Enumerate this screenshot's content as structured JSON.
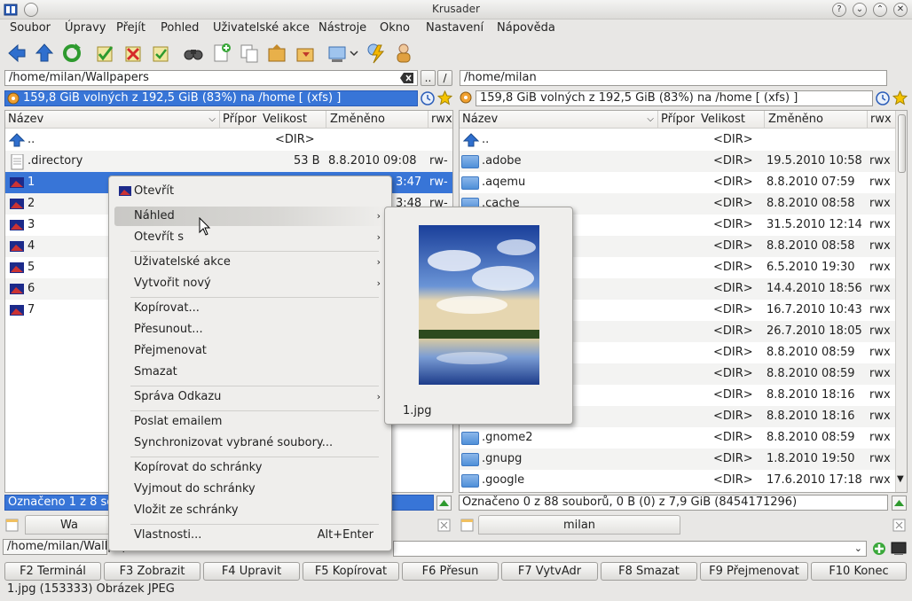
{
  "window": {
    "title": "Krusader"
  },
  "menubar": [
    "Soubor",
    "Úpravy",
    "Přejít",
    "Pohled",
    "Uživatelské akce",
    "Nástroje",
    "Okno",
    "Nastavení",
    "Nápověda"
  ],
  "left": {
    "path": "/home/milan/Wallpapers",
    "free": "159,8 GiB volných z 192,5 GiB (83%) na /home [ (xfs) ]",
    "columns": {
      "name": "Název",
      "ext": "Přípor",
      "size": "Velikost",
      "modified": "Změněno",
      "perm": "rwx"
    },
    "rows": [
      {
        "name": "..",
        "size": "<DIR>",
        "date": "",
        "perm": ""
      },
      {
        "name": ".directory",
        "size": "53 B",
        "date": "8.8.2010 09:08",
        "perm": "rw-"
      },
      {
        "name": "1",
        "size": "",
        "date": "3:47",
        "perm": "rw-"
      },
      {
        "name": "2",
        "size": "",
        "date": "3:48",
        "perm": "rw-"
      },
      {
        "name": "3",
        "size": "",
        "date": "",
        "perm": ""
      },
      {
        "name": "4",
        "size": "",
        "date": "",
        "perm": ""
      },
      {
        "name": "5",
        "size": "",
        "date": "",
        "perm": ""
      },
      {
        "name": "6",
        "size": "",
        "date": "",
        "perm": ""
      },
      {
        "name": "7",
        "size": "",
        "date": "",
        "perm": ""
      }
    ],
    "status": "Označeno 1 z 8 soub",
    "tab": "Wa",
    "cmdpath": "/home/milan/Wallpap"
  },
  "right": {
    "path": "/home/milan",
    "free": "159,8 GiB volných z 192,5 GiB (83%) na /home [ (xfs) ]",
    "columns": {
      "name": "Název",
      "ext": "Přípor",
      "size": "Velikost",
      "modified": "Změněno",
      "perm": "rwx"
    },
    "rows": [
      {
        "name": "..",
        "size": "<DIR>",
        "date": "",
        "perm": ""
      },
      {
        "name": ".adobe",
        "size": "<DIR>",
        "date": "19.5.2010 10:58",
        "perm": "rwx"
      },
      {
        "name": ".aqemu",
        "size": "<DIR>",
        "date": "8.8.2010 07:59",
        "perm": "rwx"
      },
      {
        "name": ".cache",
        "size": "<DIR>",
        "date": "8.8.2010 08:58",
        "perm": "rwx"
      },
      {
        "name": "",
        "size": "<DIR>",
        "date": "31.5.2010 12:14",
        "perm": "rwx"
      },
      {
        "name": "",
        "size": "<DIR>",
        "date": "8.8.2010 08:58",
        "perm": "rwx"
      },
      {
        "name": "",
        "size": "<DIR>",
        "date": "6.5.2010 19:30",
        "perm": "rwx"
      },
      {
        "name": "",
        "size": "<DIR>",
        "date": "14.4.2010 18:56",
        "perm": "rwx"
      },
      {
        "name": "",
        "size": "<DIR>",
        "date": "16.7.2010 10:43",
        "perm": "rwx"
      },
      {
        "name": "",
        "size": "<DIR>",
        "date": "26.7.2010 18:05",
        "perm": "rwx"
      },
      {
        "name": "",
        "size": "<DIR>",
        "date": "8.8.2010 08:59",
        "perm": "rwx"
      },
      {
        "name": "",
        "size": "<DIR>",
        "date": "8.8.2010 08:59",
        "perm": "rwx"
      },
      {
        "name": "",
        "size": "<DIR>",
        "date": "8.8.2010 18:16",
        "perm": "rwx"
      },
      {
        "name": "",
        "size": "<DIR>",
        "date": "8.8.2010 18:16",
        "perm": "rwx"
      },
      {
        "name": ".gnome2",
        "size": "<DIR>",
        "date": "8.8.2010 08:59",
        "perm": "rwx"
      },
      {
        "name": ".gnupg",
        "size": "<DIR>",
        "date": "1.8.2010 19:50",
        "perm": "rwx"
      },
      {
        "name": ".google",
        "size": "<DIR>",
        "date": "17.6.2010 17:18",
        "perm": "rwx"
      }
    ],
    "status": "Označeno 0 z 88 souborů, 0 B  (0) z 7,9 GiB (8454171296)",
    "tab": "milan"
  },
  "context_menu": {
    "items": [
      {
        "label": "Otevřít",
        "submenu": false
      },
      {
        "label": "Náhled",
        "submenu": true
      },
      {
        "label": "Otevřít s",
        "submenu": true
      },
      {
        "label": "Uživatelské akce",
        "submenu": true
      },
      {
        "label": "Vytvořit nový",
        "submenu": true
      },
      {
        "label": "Kopírovat...",
        "submenu": false
      },
      {
        "label": "Přesunout...",
        "submenu": false
      },
      {
        "label": "Přejmenovat",
        "submenu": false
      },
      {
        "label": "Smazat",
        "submenu": false
      },
      {
        "label": "Správa Odkazu",
        "submenu": true
      },
      {
        "label": "Poslat emailem",
        "submenu": false
      },
      {
        "label": "Synchronizovat vybrané soubory...",
        "submenu": false
      },
      {
        "label": "Kopírovat do schránky",
        "submenu": false
      },
      {
        "label": "Vyjmout do schránky",
        "submenu": false
      },
      {
        "label": "Vložit ze schránky",
        "submenu": false
      },
      {
        "label": "Vlastnosti...",
        "submenu": false,
        "shortcut": "Alt+Enter"
      }
    ]
  },
  "preview": {
    "filename": "1.jpg"
  },
  "fkeys": [
    "F2 Terminál",
    "F3 Zobrazit",
    "F4 Upravit",
    "F5 Kopírovat",
    "F6 Přesun",
    "F7 VytvAdr",
    "F8 Smazat",
    "F9 Přejmenovat",
    "F10 Konec"
  ],
  "bottom_status": "1.jpg (153333)  Obrázek JPEG",
  "colors": {
    "selection": "#3875d7",
    "accent_blue": "#4f8fd8"
  }
}
